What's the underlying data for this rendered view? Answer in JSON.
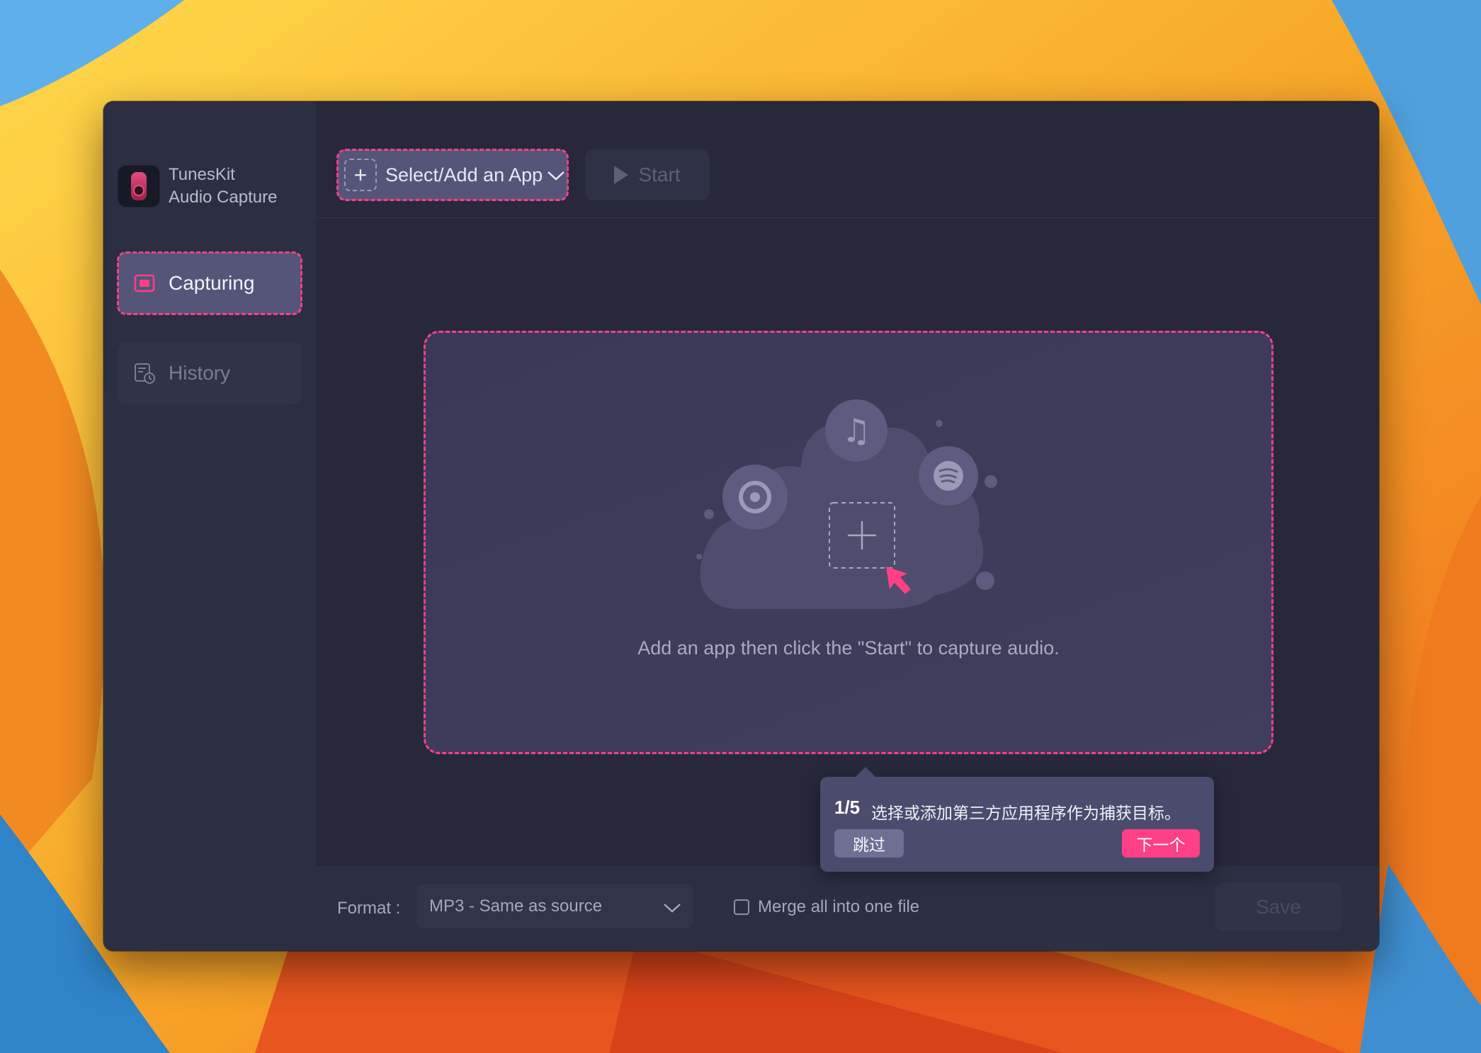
{
  "app": {
    "name_line1": "TunesKit",
    "name_line2": "Audio Capture"
  },
  "sidebar": {
    "items": [
      {
        "label": "Capturing",
        "icon": "capture-icon",
        "active": true
      },
      {
        "label": "History",
        "icon": "history-icon",
        "active": false
      }
    ]
  },
  "toolbar": {
    "select_app_label": "Select/Add an App",
    "start_label": "Start"
  },
  "dropzone": {
    "hint": "Add an app then click the \"Start\" to capture audio.",
    "icons": [
      "music-note-icon",
      "chrome-icon",
      "spotify-icon",
      "add-app-icon",
      "cursor-icon"
    ]
  },
  "tooltip": {
    "step": "1/5",
    "text": "选择或添加第三方应用程序作为捕获目标。",
    "skip_label": "跳过",
    "next_label": "下一个"
  },
  "footer": {
    "format_label": "Format :",
    "format_value": "MP3 - Same as source",
    "merge_label": "Merge all into one file",
    "merge_checked": false,
    "save_label": "Save"
  },
  "colors": {
    "accent": "#ff3f86",
    "window_bg": "#272839",
    "sidebar_bg": "#2c2e42",
    "active_item_bg": "#55557a"
  }
}
